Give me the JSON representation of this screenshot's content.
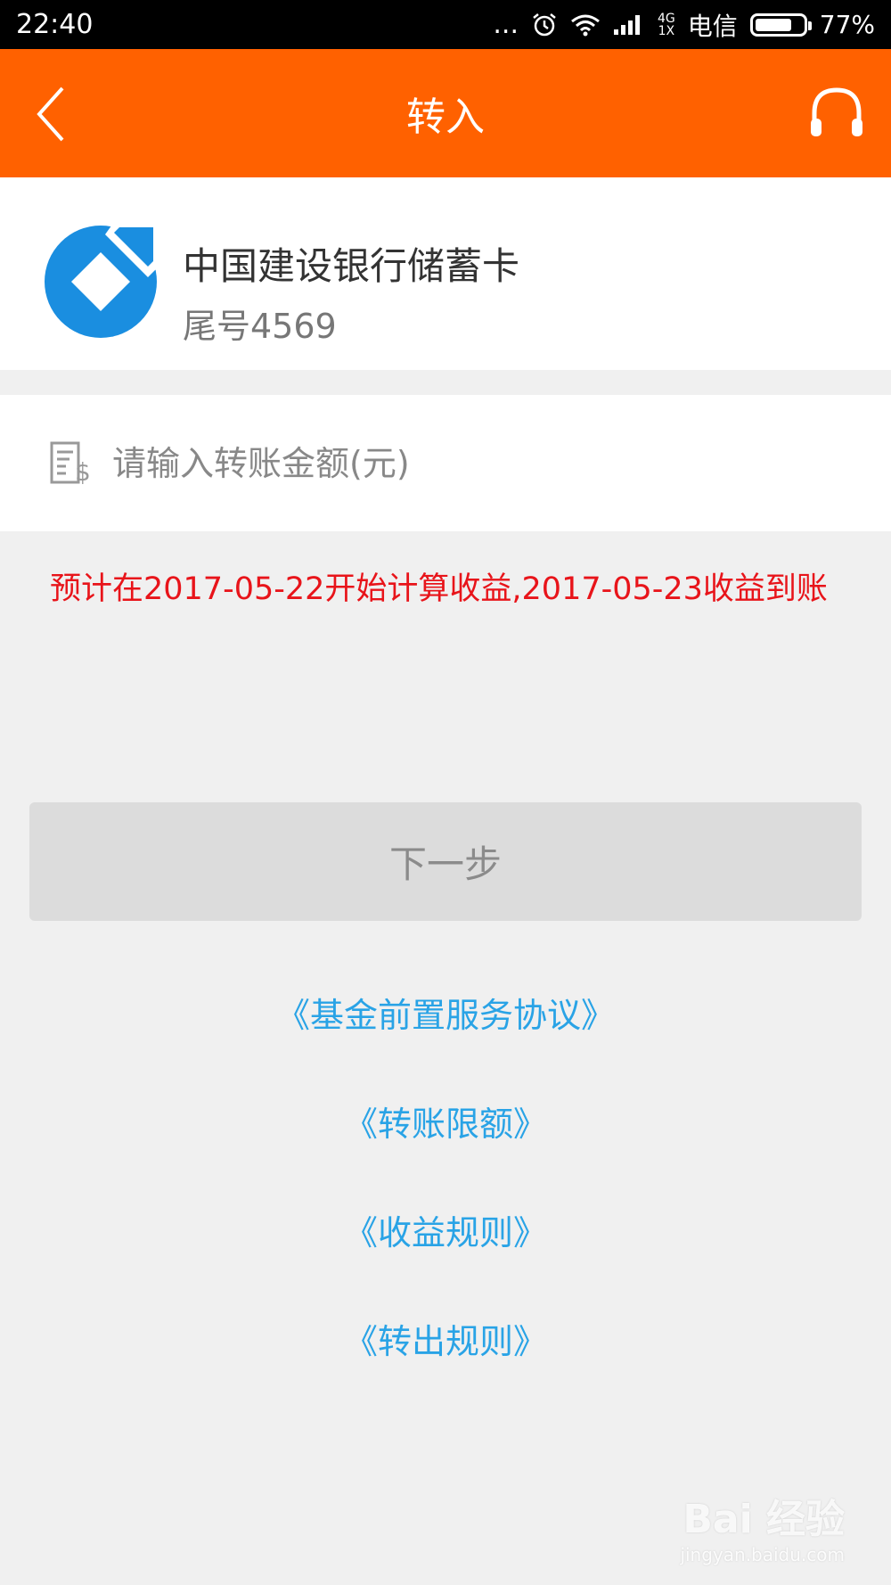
{
  "status_bar": {
    "time": "22:40",
    "dots": "...",
    "network_top": "4G",
    "network_bottom": "1X",
    "carrier": "电信",
    "battery_percent": "77%",
    "battery_level": 0.77,
    "icons": [
      "more-icon",
      "alarm-icon",
      "wifi-icon",
      "signal-icon",
      "battery-icon"
    ]
  },
  "nav": {
    "title": "转入",
    "back_icon": "chevron-left-icon",
    "support_icon": "headset-icon"
  },
  "bank_card": {
    "name": "中国建设银行储蓄卡",
    "tail": "尾号4569",
    "logo_color": "#1a8ee0"
  },
  "amount": {
    "value": "",
    "placeholder": "请输入转账金额(元)",
    "icon": "bill-dollar-icon"
  },
  "notice": "预计在2017-05-22开始计算收益,2017-05-23收益到账",
  "next_button": "下一步",
  "links": {
    "fund_agreement": "《基金前置服务协议》",
    "transfer_limit": "《转账限额》",
    "income_rules": "《收益规则》",
    "transfer_out_rules": "《转出规则》"
  },
  "watermark": {
    "main": "Bai 经验",
    "sub": "jingyan.baidu.com"
  },
  "colors": {
    "accent": "#ff6100",
    "link": "#29a3e6",
    "notice": "#e8141a"
  }
}
